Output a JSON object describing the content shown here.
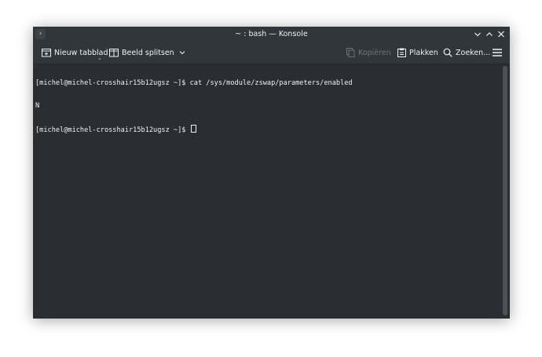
{
  "window": {
    "title": "~ : bash — Konsole"
  },
  "titlebar": {
    "menu_glyph": "›",
    "minimize_glyph": "⌄",
    "maximize_glyph": "⌃",
    "close_glyph": "✕"
  },
  "toolbar": {
    "new_tab_label": "Nieuw tabblad",
    "split_view_label": "Beeld splitsen",
    "copy_label": "Kopiëren",
    "paste_label": "Plakken",
    "find_label": "Zoeken...",
    "icons": {
      "new_tab": "new-tab-icon",
      "split_view": "split-view-icon",
      "copy": "copy-icon",
      "paste": "paste-icon",
      "find": "search-icon",
      "menu": "hamburger-menu-icon"
    }
  },
  "terminal": {
    "lines": [
      "[michel@michel-crosshair15b12ugsz ~]$ cat /sys/module/zswap/parameters/enabled",
      "N",
      "[michel@michel-crosshair15b12ugsz ~]$ "
    ]
  },
  "colors": {
    "terminal_bg": "#2a2e32",
    "chrome_bg": "#31363b",
    "text": "#eff0f1",
    "disabled_text": "#6e7377"
  }
}
